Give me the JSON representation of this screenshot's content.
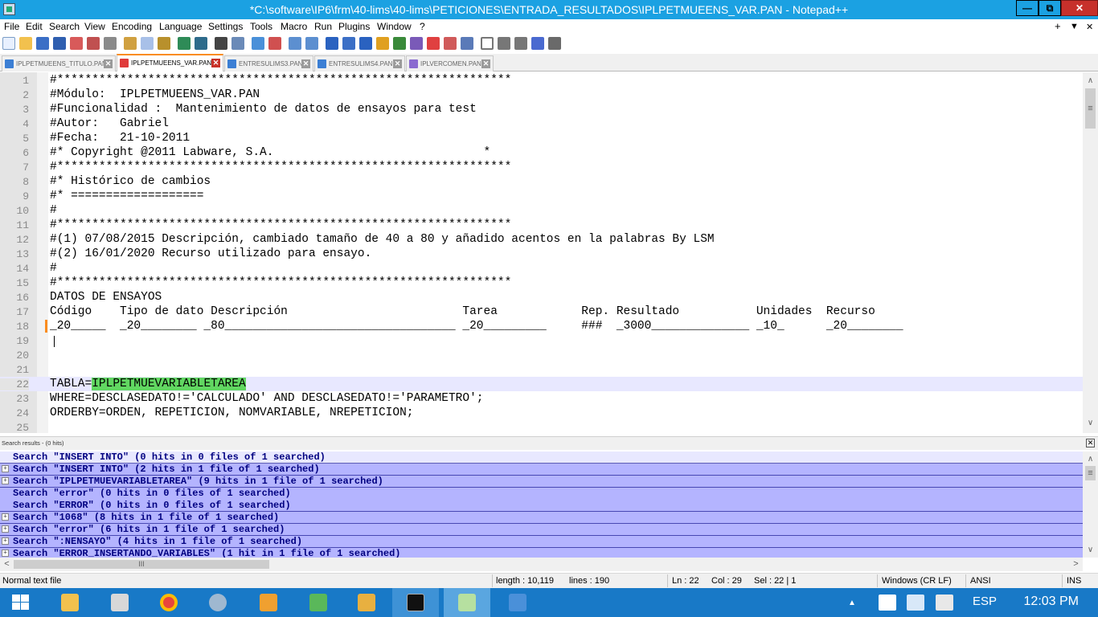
{
  "window": {
    "title": "*C:\\software\\IP6\\frm\\40-lims\\40-lims\\PETICIONES\\ENTRADA_RESULTADOS\\IPLPETMUEENS_VAR.PAN - Notepad++",
    "minimize": "—",
    "restore": "⧉",
    "close": "✕"
  },
  "menu": {
    "items": [
      "File",
      "Edit",
      "Search",
      "View",
      "Encoding",
      "Language",
      "Settings",
      "Tools",
      "Macro",
      "Run",
      "Plugins",
      "Window",
      "?"
    ],
    "right_plus": "+",
    "right_down": "▼",
    "right_close": "✕"
  },
  "tabs": [
    {
      "label": "IPLPETMUEENS_TITULO.PAN",
      "active": false
    },
    {
      "label": "IPLPETMUEENS_VAR.PAN",
      "active": true
    },
    {
      "label": "ENTRESULIMS3.PAN",
      "active": false
    },
    {
      "label": "ENTRESULIMS4.PAN",
      "active": false
    },
    {
      "label": "IPLVERCOMEN.PAN",
      "active": false
    }
  ],
  "tab_close_glyph": "✕",
  "editor": {
    "lines": [
      {
        "num": "1",
        "text": "#*****************************************************************"
      },
      {
        "num": "2",
        "text": "#Módulo:  IPLPETMUEENS_VAR.PAN"
      },
      {
        "num": "3",
        "text": "#Funcionalidad :  Mantenimiento de datos de ensayos para test"
      },
      {
        "num": "4",
        "text": "#Autor:   Gabriel"
      },
      {
        "num": "5",
        "text": "#Fecha:   21-10-2011"
      },
      {
        "num": "6",
        "text": "#* Copyright @2011 Labware, S.A.                              *"
      },
      {
        "num": "7",
        "text": "#*****************************************************************"
      },
      {
        "num": "8",
        "text": "#* Histórico de cambios"
      },
      {
        "num": "9",
        "text": "#* ==================="
      },
      {
        "num": "10",
        "text": "#"
      },
      {
        "num": "11",
        "text": "#*****************************************************************"
      },
      {
        "num": "12",
        "text": "#(1) 07/08/2015 Descripción, cambiado tamaño de 40 a 80 y añadido acentos en la palabras By LSM"
      },
      {
        "num": "13",
        "text": "#(2) 16/01/2020 Recurso utilizado para ensayo."
      },
      {
        "num": "14",
        "text": "#"
      },
      {
        "num": "15",
        "text": "#*****************************************************************"
      },
      {
        "num": "16",
        "text": "DATOS DE ENSAYOS"
      },
      {
        "num": "17",
        "text": "Código    Tipo de dato Descripción                         Tarea            Rep. Resultado           Unidades  Recurso"
      },
      {
        "num": "18",
        "text": "_20_____  _20________ _80_________________________________ _20_________     ###  _3000______________ _10_      _20________"
      },
      {
        "num": "19",
        "text": ""
      },
      {
        "num": "20",
        "text": ""
      },
      {
        "num": "21",
        "text": ""
      },
      {
        "num": "22",
        "text_prefix": "TABLA=",
        "text_highlight": "IPLPETMUEVARIABLETAREA"
      },
      {
        "num": "23",
        "text": "WHERE=DESCLASEDATO!='CALCULADO' AND DESCLASEDATO!='PARAMETRO';"
      },
      {
        "num": "24",
        "text": "ORDERBY=ORDEN, REPETICION, NOMVARIABLE, NREPETICION;"
      },
      {
        "num": "25",
        "text": ""
      }
    ]
  },
  "search_panel": {
    "title": "Search results - (0 hits)",
    "close": "✕",
    "expander_glyph": "+",
    "results": [
      {
        "text": "Search \"INSERT INTO\" (0 hits in 0 files of 1 searched)",
        "expandable": false
      },
      {
        "text": "Search \"INSERT INTO\" (2 hits in 1 file of 1 searched)",
        "expandable": true
      },
      {
        "text": "Search \"IPLPETMUEVARIABLETAREA\" (9 hits in 1 file of 1 searched)",
        "expandable": true
      },
      {
        "text": "Search \"error\" (0 hits in 0 files of 1 searched)",
        "expandable": false
      },
      {
        "text": "Search \"ERROR\" (0 hits in 0 files of 1 searched)",
        "expandable": false
      },
      {
        "text": "Search \"1068\" (8 hits in 1 file of 1 searched)",
        "expandable": true
      },
      {
        "text": "Search \"error\" (6 hits in 1 file of 1 searched)",
        "expandable": true
      },
      {
        "text": "Search \":NENSAYO\" (4 hits in 1 file of 1 searched)",
        "expandable": true
      },
      {
        "text": "Search \"ERROR_INSERTANDO_VARIABLES\" (1 hit in 1 file of 1 searched)",
        "expandable": true
      }
    ]
  },
  "scroll": {
    "up": "∧",
    "down": "∨",
    "left": "<",
    "right": ">",
    "thumb_grip": "≡",
    "hthumb_grip": "III"
  },
  "status": {
    "file_type": "Normal text file",
    "length": "length : 10,119",
    "lines": "lines : 190",
    "ln": "Ln : 22",
    "col": "Col : 29",
    "sel": "Sel : 22 | 1",
    "eol": "Windows (CR LF)",
    "encoding": "ANSI",
    "mode": "INS"
  },
  "taskbar": {
    "language": "ESP",
    "time": "12:03 PM",
    "tray_up": "▲"
  },
  "colors": {
    "title_bar": "#1ba1e2",
    "current_line": "#e8e8ff",
    "find_highlight": "#61d761",
    "search_row": "#b4b4ff",
    "search_text": "#000080",
    "taskbar": "#1879c7"
  }
}
